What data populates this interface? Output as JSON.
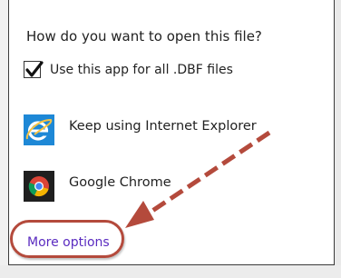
{
  "dialog": {
    "title": "How do you want to open this file?",
    "checkbox": {
      "label": "Use this app for all .DBF files",
      "checked": true
    },
    "apps": [
      {
        "label": "Keep using Internet Explorer",
        "icon": "internet-explorer-icon"
      },
      {
        "label": "Google Chrome",
        "icon": "google-chrome-icon"
      }
    ],
    "more_options": "More options"
  },
  "colors": {
    "link": "#5a2bc0",
    "annotation": "#b44a3c",
    "ie_tile": "#1e88d6",
    "chrome_tile": "#1f1f1f"
  }
}
